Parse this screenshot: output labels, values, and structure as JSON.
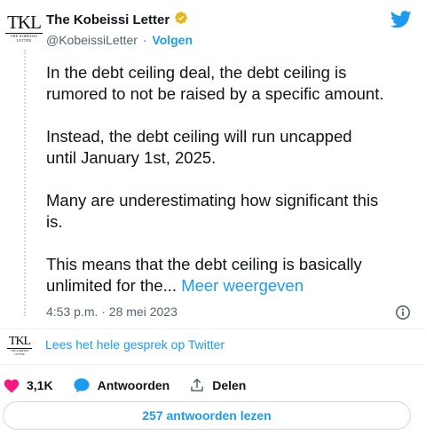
{
  "author": {
    "name": "The Kobeissi Letter",
    "handle": "@KobeissiLetter",
    "follow_label": "Volgen",
    "avatar_monogram": "TKL",
    "avatar_subtitle": "THE KOBEISSI LETTER",
    "verified_badge_color": "#e2b719",
    "avatar_icon": "kobeissi-logo"
  },
  "tweet": {
    "paragraphs": [
      [
        "In the debt ceiling deal, the debt ceiling is",
        "rumored to not be raised by a specific amount."
      ],
      [
        "Instead, the debt ceiling will run uncapped",
        "until January 1st, 2025."
      ],
      [
        "Many are underestimating how significant this",
        "is."
      ],
      [
        "This means that the debt ceiling is basically",
        "unlimited for the..."
      ]
    ],
    "show_more_label": "Meer weergeven",
    "timestamp": "4:53 p.m. · 28 mei 2023"
  },
  "read_thread_label": "Lees het hele gesprek op Twitter",
  "actions": {
    "likes_count": "3,1K",
    "reply_label": "Antwoorden",
    "share_label": "Delen"
  },
  "replies_button_label": "257 antwoorden lezen",
  "colors": {
    "accent": "#1d9bf0",
    "like": "#f91880",
    "text": "#0f1419",
    "muted": "#536471"
  },
  "icons": [
    "verified-badge-icon",
    "twitter-bird-icon",
    "info-icon",
    "heart-icon",
    "reply-bubble-icon",
    "share-icon"
  ]
}
